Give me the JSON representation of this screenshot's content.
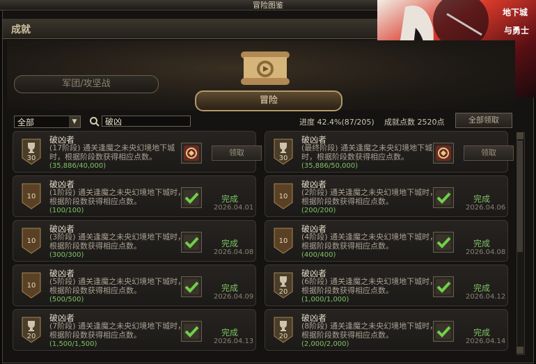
{
  "window": {
    "title": "冒险图鉴"
  },
  "header": {
    "title": "成就"
  },
  "tabs": [
    {
      "label": "军团/攻坚战",
      "active": false
    },
    {
      "label": "冒险",
      "active": true
    }
  ],
  "filter": {
    "selected": "全部"
  },
  "search": {
    "value": "破凶"
  },
  "stats": {
    "progress": "进度 42.4%(87/205)",
    "points": "成就点数 2520点"
  },
  "claim_all_label": "全部领取",
  "achievements": [
    {
      "name": "破凶者",
      "desc": "(17阶段) 通关逢魔之未央幻境地下城时，根据阶段数获得相应点数。",
      "progress": "(35,886/40,000)",
      "points": "30",
      "badge": "trophy",
      "claimed": false,
      "action": "领取",
      "date": ""
    },
    {
      "name": "破凶者",
      "desc": "(最终阶段) 通关逢魔之未央幻境地下城时，根据阶段数获得相应点数。",
      "progress": "(35,886/50,000)",
      "points": "30",
      "badge": "trophy",
      "claimed": false,
      "action": "领取",
      "date": ""
    },
    {
      "name": "破凶者",
      "desc": "(1阶段) 通关逢魔之未央幻境地下城时，根据阶段数获得相应点数。",
      "progress": "(100/100)",
      "points": "10",
      "badge": "plain",
      "claimed": true,
      "action": "完成",
      "date": "2026.04.01"
    },
    {
      "name": "破凶者",
      "desc": "(2阶段) 通关逢魔之未央幻境地下城时，根据阶段数获得相应点数。",
      "progress": "(200/200)",
      "points": "10",
      "badge": "plain",
      "claimed": true,
      "action": "完成",
      "date": "2026.04.06"
    },
    {
      "name": "破凶者",
      "desc": "(3阶段) 通关逢魔之未央幻境地下城时，根据阶段数获得相应点数。",
      "progress": "(300/300)",
      "points": "10",
      "badge": "plain",
      "claimed": true,
      "action": "完成",
      "date": "2026.04.08"
    },
    {
      "name": "破凶者",
      "desc": "(4阶段) 通关逢魔之未央幻境地下城时，根据阶段数获得相应点数。",
      "progress": "(400/400)",
      "points": "10",
      "badge": "plain",
      "claimed": true,
      "action": "完成",
      "date": "2026.04.08"
    },
    {
      "name": "破凶者",
      "desc": "(5阶段) 通关逢魔之未央幻境地下城时，根据阶段数获得相应点数。",
      "progress": "(500/500)",
      "points": "10",
      "badge": "plain",
      "claimed": true,
      "action": "完成",
      "date": "2026.04.09"
    },
    {
      "name": "破凶者",
      "desc": "(6阶段) 通关逢魔之未央幻境地下城时，根据阶段数获得相应点数。",
      "progress": "(1,000/1,000)",
      "points": "20",
      "badge": "trophy",
      "claimed": true,
      "action": "完成",
      "date": "2026.04.12"
    },
    {
      "name": "破凶者",
      "desc": "(7阶段) 通关逢魔之未央幻境地下城时，根据阶段数获得相应点数。",
      "progress": "(1,500/1,500)",
      "points": "20",
      "badge": "trophy",
      "claimed": true,
      "action": "完成",
      "date": "2026.04.13"
    },
    {
      "name": "破凶者",
      "desc": "(8阶段) 通关逢魔之未央幻境地下城时，根据阶段数获得相应点数。",
      "progress": "(2,000/2,000)",
      "points": "20",
      "badge": "trophy",
      "claimed": true,
      "action": "完成",
      "date": "2026.04.14"
    }
  ],
  "colors": {
    "progress_green": "#7ec464",
    "panel_bg": "#141311",
    "gold": "#b39a6a"
  }
}
